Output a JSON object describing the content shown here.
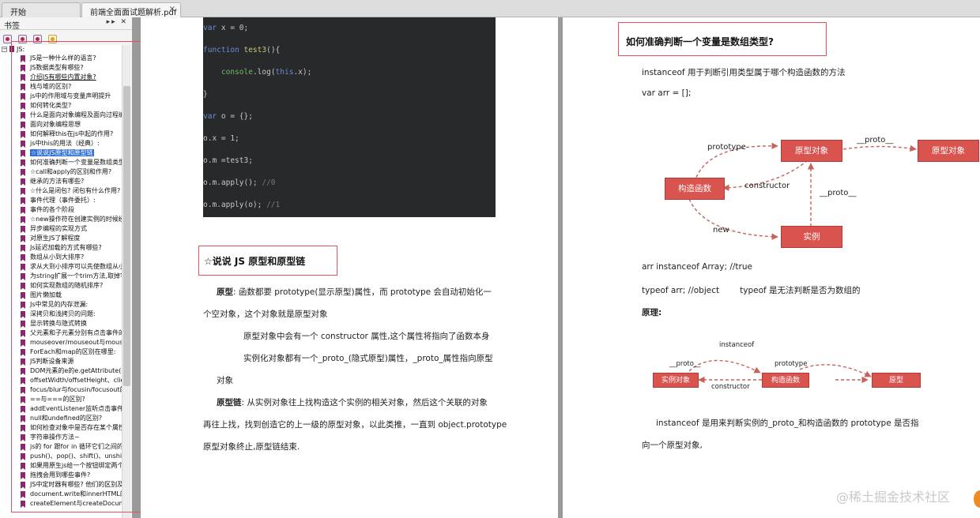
{
  "tabs": [
    {
      "label": "开始"
    },
    {
      "label": "前端全面面试题解析.pdf",
      "close": "×"
    }
  ],
  "sidebar": {
    "title": "书签",
    "controls": "▸▸ ✕",
    "root_label": "JS:",
    "items": [
      {
        "label": "JS是一种什么样的语言?"
      },
      {
        "label": "JS数据类型有哪些?"
      },
      {
        "label": "介绍JS有哪些内置对象?"
      },
      {
        "label": "栈与堆的区别?"
      },
      {
        "label": "js中的作用域与变量声明提升"
      },
      {
        "label": "如何转化类型?"
      },
      {
        "label": "什么是面向对象编程及面向过程编"
      },
      {
        "label": "面向对象编程思想"
      },
      {
        "label": "如何解释this在js中起的作用?"
      },
      {
        "label": "js中this的用法（经典）:"
      },
      {
        "label": "☆说说JS原型和原型链"
      },
      {
        "label": "如何准确判断一个变量是数组类型"
      },
      {
        "label": "☆call和apply的区别和作用?"
      },
      {
        "label": "继承的方法有哪些?"
      },
      {
        "label": "☆什么是闭包? 闭包有什么作用?"
      },
      {
        "label": "事件代理（事件委托）:"
      },
      {
        "label": "事件的各个阶段"
      },
      {
        "label": "☆new操作符在创建实例的时候经历"
      },
      {
        "label": "异步编程的实现方式"
      },
      {
        "label": "对原生JS了解程度"
      },
      {
        "label": "Js延迟加载的方式有哪些?"
      },
      {
        "label": "数组从小到大排序?"
      },
      {
        "label": "求从大到小排序可以先使数组从小"
      },
      {
        "label": "为string扩展一个trim方法,取掉字"
      },
      {
        "label": "如何实现数组的随机排序?"
      },
      {
        "label": "图片懒加载"
      },
      {
        "label": "Js中常见的内存泄漏:"
      },
      {
        "label": "深拷贝和浅拷贝的问题:"
      },
      {
        "label": "显示转换与隐式转换"
      },
      {
        "label": "父元素和子元素分别有点击事件的"
      },
      {
        "label": "mouseover/mouseout与mouseen"
      },
      {
        "label": "ForEach和map的区别在哪里:"
      },
      {
        "label": "JS判断设备来源"
      },
      {
        "label": "DOM元素的e的e.getAttribute(p"
      },
      {
        "label": "offsetWidth/offsetHeight、clien"
      },
      {
        "label": "focus/blur与focusin/focusout的区"
      },
      {
        "label": "==与===的区别?"
      },
      {
        "label": "addEventListener监听点击事件与"
      },
      {
        "label": "null和undefined的区别?"
      },
      {
        "label": "如何检查对象中是否存在某个属性"
      },
      {
        "label": "字符串操作方法~"
      },
      {
        "label": "js的 for 跟for in 循环它们之间的"
      },
      {
        "label": "push()、pop()、shift()、unshift"
      },
      {
        "label": "如果用原生js给一个按钮绑定两个"
      },
      {
        "label": "拖拽会用到哪些事件?"
      },
      {
        "label": "JS中定时器有哪些? 他们的区别及"
      },
      {
        "label": "document.write和innerHTML的区"
      },
      {
        "label": "createElement与createDocume"
      }
    ]
  },
  "page1": {
    "code_lines": [
      {
        "parts": [
          [
            "kw",
            "var "
          ],
          [
            "t",
            "x = 0;"
          ]
        ]
      },
      {
        "parts": [
          [
            "kw",
            "function "
          ],
          [
            "fn",
            "test3"
          ],
          [
            "t",
            "(){"
          ]
        ]
      },
      {
        "parts": [
          [
            "t",
            "    "
          ],
          [
            "str",
            "console"
          ],
          [
            "t",
            ".log("
          ],
          [
            "kw",
            "this"
          ],
          [
            "t",
            ".x);"
          ]
        ]
      },
      {
        "parts": [
          [
            "t",
            "}"
          ]
        ]
      },
      {
        "parts": [
          [
            "kw",
            "var "
          ],
          [
            "t",
            "o = {};"
          ]
        ]
      },
      {
        "parts": [
          [
            "t",
            "o.x = 1;"
          ]
        ]
      },
      {
        "parts": [
          [
            "t",
            "o.m =test3;"
          ]
        ]
      },
      {
        "parts": [
          [
            "t",
            "o.m.apply(); "
          ],
          [
            "cm",
            "//0"
          ]
        ]
      },
      {
        "parts": [
          [
            "t",
            "o.m.apply(o); "
          ],
          [
            "cm",
            "//1"
          ]
        ]
      }
    ],
    "heading": "☆说说 JS 原型和原型链",
    "proto_label": "原型",
    "proto_line1": ": 函数都要 prototype(显示原型)属性，而 prototype 会自动初始化一",
    "proto_line2": "个空对象，这个对象就是原型对象",
    "proto_line3": "原型对象中会有一个 constructor 属性,这个属性将指向了函数本身",
    "proto_line4": "实例化对象都有一个_proto_(隐式原型)属性，_proto_属性指向原型",
    "proto_line5": "对象",
    "chain_label": "原型链",
    "chain_line1": ": 从实例对象往上找构造这个实例的相关对象，然后这个关联的对象",
    "chain_line2": "再往上找，找到创造它的上一级的原型对象，以此类推，一直到 object.prototype",
    "chain_line3": "原型对象终止,原型链结束."
  },
  "page2": {
    "heading": "如何准确判断一个变量是数组类型?",
    "line1": "instanceof 用于判断引用类型属于哪个构造函数的方法",
    "line2": "var arr = [];",
    "diagram1": {
      "proto_obj1": "原型对象",
      "proto_obj2": "原型对象",
      "ctor": "构造函数",
      "instance": "实例",
      "prototype": "prototype",
      "proto_top": "__proto__",
      "constructor": "constructor",
      "proto_vert": "__proto__",
      "new": "new"
    },
    "line3": "arr   instanceof   Array;     //true",
    "line4a": "typeof   arr;      //object",
    "line4b": "typeof 是无法判断是否为数组的",
    "yuanxing": "原理:",
    "diagram2": {
      "instance_obj": "实例对象",
      "ctor": "构造函数",
      "proto": "原型",
      "instanceof": "instanceof",
      "proto_lbl": "__proto__",
      "prototype": "prototype",
      "constructor": "constructor"
    },
    "line5": "instanceof 是用来判断实例的_proto_和构造函数的 prototype 是否指",
    "line6": "向一个原型对象,"
  },
  "watermark": "@稀土掘金技术社区"
}
